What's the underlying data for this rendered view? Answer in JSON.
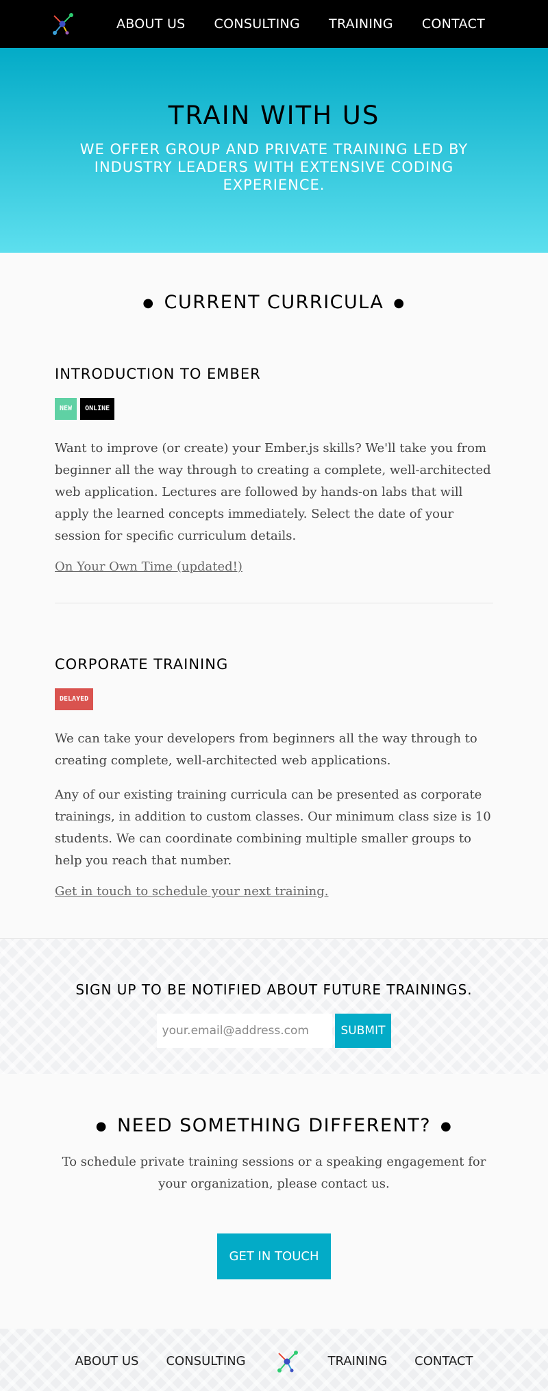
{
  "nav": {
    "logo_icon": "network-node-icon",
    "items": [
      {
        "label": "ABOUT US"
      },
      {
        "label": "CONSULTING"
      },
      {
        "label": "TRAINING"
      },
      {
        "label": "CONTACT"
      }
    ]
  },
  "hero": {
    "title": "TRAIN WITH US",
    "subtitle": "We offer group and private training led by industry leaders with extensive coding experience."
  },
  "curricula": {
    "title": "CURRENT CURRICULA",
    "courses": [
      {
        "title": "INTRODUCTION TO EMBER",
        "badges": [
          "NEW",
          "ONLINE"
        ],
        "paragraphs": [
          "Want to improve (or create) your Ember.js skills? We'll take you from beginner all the way through to creating a complete, well-architected web application. Lectures are followed by hands-on labs that will apply the learned concepts immediately. Select the date of your session for specific curriculum details."
        ],
        "link": "On Your Own Time (updated!)"
      },
      {
        "title": "CORPORATE TRAINING",
        "badges": [
          "DELAYED"
        ],
        "paragraphs": [
          "We can take your developers from beginners all the way through to creating complete, well-architected web applications.",
          "Any of our existing training curricula can be presented as corporate trainings, in addition to custom classes. Our minimum class size is 10 students. We can coordinate combining multiple smaller groups to help you reach that number."
        ],
        "link": "Get in touch to schedule your next training."
      }
    ]
  },
  "signup": {
    "title": "SIGN UP TO BE NOTIFIED ABOUT FUTURE TRAININGS.",
    "placeholder": "your.email@address.com",
    "submit_label": "SUBMIT"
  },
  "different": {
    "title": "NEED SOMETHING DIFFERENT?",
    "text": "To schedule private training sessions or a speaking engagement for your organization, please contact us.",
    "cta_label": "GET IN TOUCH"
  },
  "footer": {
    "items": [
      {
        "label": "ABOUT US"
      },
      {
        "label": "CONSULTING"
      },
      {
        "label": "TRAINING"
      },
      {
        "label": "CONTACT"
      }
    ]
  },
  "colors": {
    "accent": "#03abc7",
    "badge_new": "#5fd1a4",
    "badge_online": "#000000",
    "badge_delayed": "#d9534f"
  }
}
